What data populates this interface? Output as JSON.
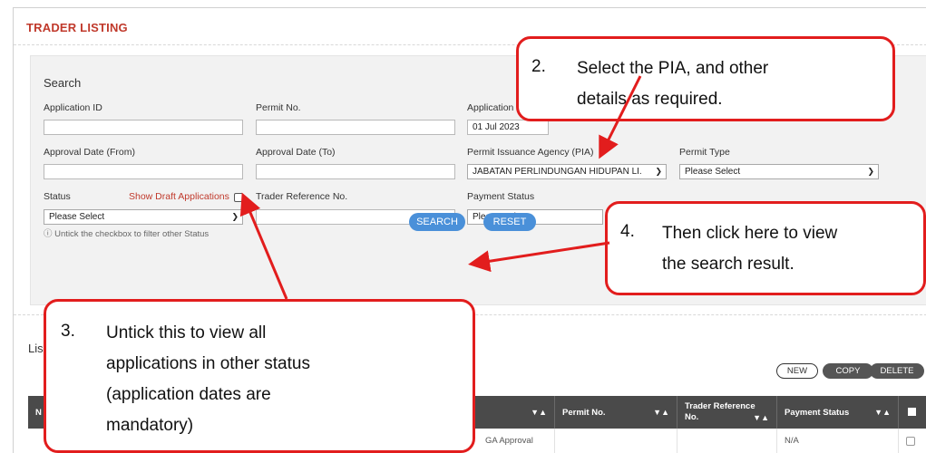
{
  "page": {
    "title": "TRADER LISTING"
  },
  "search": {
    "heading": "Search",
    "application_id": {
      "label": "Application ID",
      "value": ""
    },
    "permit_no": {
      "label": "Permit No.",
      "value": ""
    },
    "application_date_from": {
      "label": "Application",
      "value": "01 Jul 2023"
    },
    "approval_from": {
      "label": "Approval Date (From)",
      "value": ""
    },
    "approval_to": {
      "label": "Approval Date (To)",
      "value": ""
    },
    "pia": {
      "label": "Permit Issuance Agency (PIA)",
      "value": "JABATAN PERLINDUNGAN HIDUPAN LI."
    },
    "permit_type": {
      "label": "Permit Type",
      "value": "Please Select"
    },
    "status": {
      "label": "Status",
      "value": "Please Select"
    },
    "show_draft": {
      "label": "Show Draft Applications",
      "checked": false
    },
    "trader_ref": {
      "label": "Trader Reference No.",
      "value": ""
    },
    "payment_status": {
      "label": "Payment Status",
      "value": "Please Select"
    },
    "hint": "Untick the checkbox to filter other Status",
    "search_button": "SEARCH",
    "reset_button": "RESET"
  },
  "listing": {
    "label": "Lis",
    "new_button": "NEW",
    "copy_button": "COPY",
    "delete_button": "DELETE",
    "columns": {
      "first": "N",
      "sort_glyph": "▼▲",
      "permit_no": "Permit No.",
      "trader_ref_line1": "Trader Reference",
      "trader_ref_line2": "No.",
      "payment_status": "Payment Status"
    },
    "row": {
      "status_fragment": "GA Approval",
      "payment_status": "N/A"
    }
  },
  "callouts": {
    "c2": {
      "num": "2.",
      "line1": "Select the PIA, and other",
      "line2": "details as required."
    },
    "c3": {
      "num": "3.",
      "line1": "Untick this to view all",
      "line2": "applications in other status",
      "line3": "(application dates are",
      "line4": "mandatory)"
    },
    "c4": {
      "num": "4.",
      "line1": "Then click here to view",
      "line2": "the search result."
    }
  },
  "colors": {
    "title_red": "#c0392b",
    "button_blue": "#4a90d9",
    "callout_red": "#e21d1d",
    "table_header": "#4a4a4a"
  }
}
